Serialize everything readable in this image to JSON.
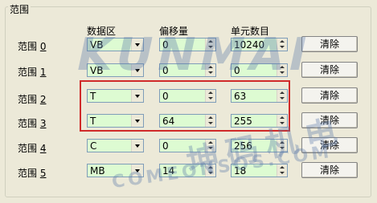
{
  "group": {
    "title": "范围"
  },
  "columns": {
    "data_area": "数据区",
    "offset": "偏移量",
    "count": "单元数目"
  },
  "rows": [
    {
      "label": "范围",
      "index": "0",
      "data_area": "VB",
      "offset": "0",
      "count": "10240",
      "clear_label": "清除"
    },
    {
      "label": "范围",
      "index": "1",
      "data_area": "VB",
      "offset": "0",
      "count": "0",
      "clear_label": "清除"
    },
    {
      "label": "范围",
      "index": "2",
      "data_area": "T",
      "offset": "0",
      "count": "63",
      "clear_label": "清除"
    },
    {
      "label": "范围",
      "index": "3",
      "data_area": "T",
      "offset": "64",
      "count": "255",
      "clear_label": "清除"
    },
    {
      "label": "范围",
      "index": "4",
      "data_area": "C",
      "offset": "0",
      "count": "256",
      "clear_label": "清除"
    },
    {
      "label": "范围",
      "index": "5",
      "data_area": "MB",
      "offset": "14",
      "count": "18",
      "clear_label": "清除"
    }
  ],
  "watermark": {
    "brand": "KUNMAI",
    "cn": "坤码机电",
    "url": "COMEONSOS.COM"
  },
  "colors": {
    "field_bg": "#ddfbd2",
    "highlight": "#d02a2a",
    "window_bg": "#ece9d8"
  }
}
